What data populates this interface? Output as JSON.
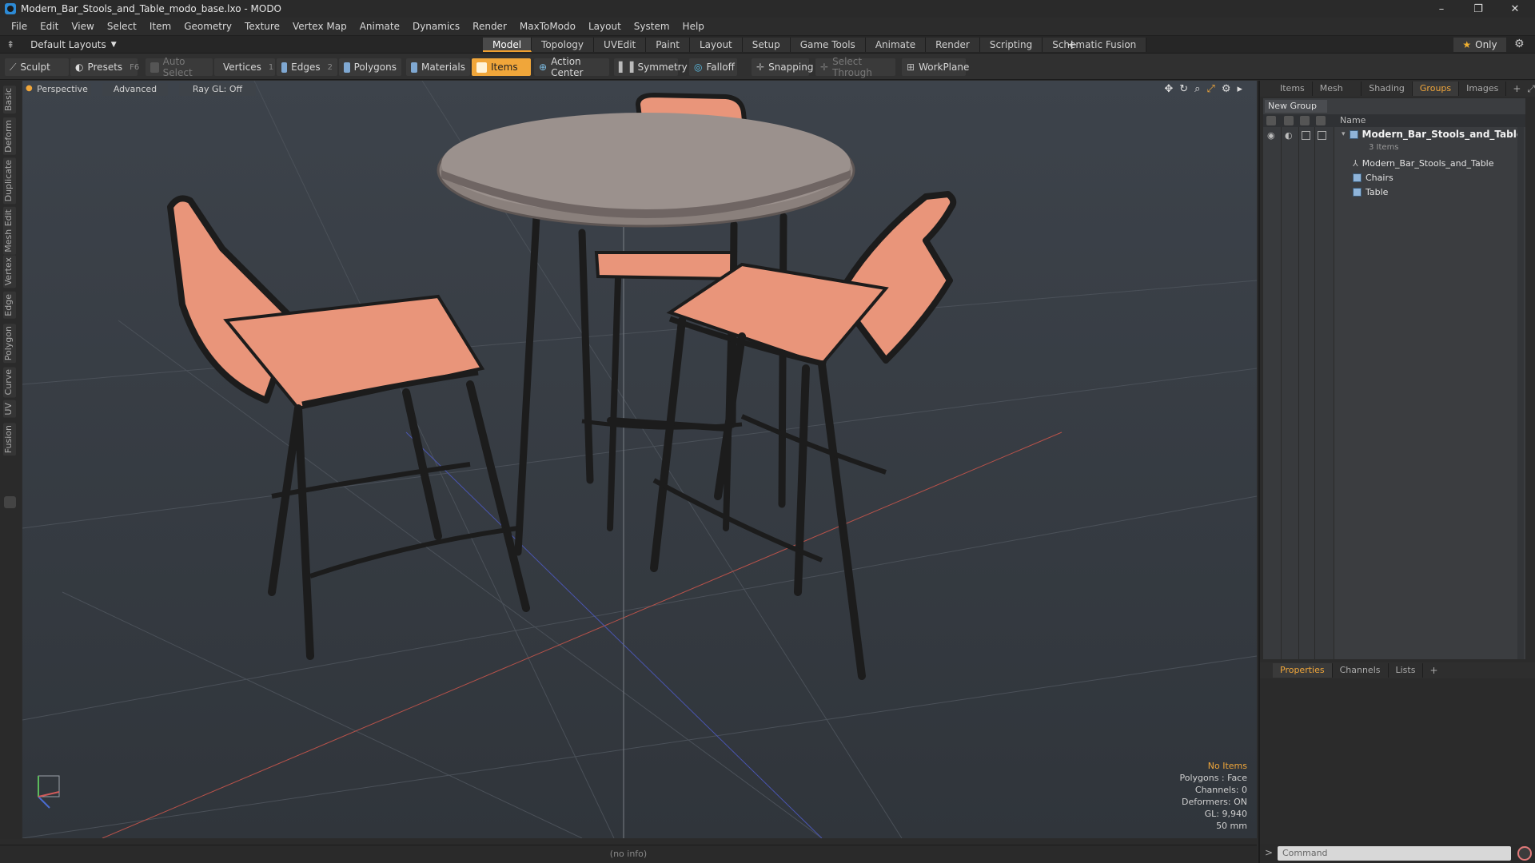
{
  "window": {
    "title": "Modern_Bar_Stools_and_Table_modo_base.lxo - MODO",
    "controls": [
      "–",
      "❐",
      "✕"
    ]
  },
  "menu": [
    "File",
    "Edit",
    "View",
    "Select",
    "Item",
    "Geometry",
    "Texture",
    "Vertex Map",
    "Animate",
    "Dynamics",
    "Render",
    "MaxToModo",
    "Layout",
    "System",
    "Help"
  ],
  "layout": {
    "dropdown": "Default Layouts",
    "tabs": [
      "Model",
      "Topology",
      "UVEdit",
      "Paint",
      "Layout",
      "Setup",
      "Game Tools",
      "Animate",
      "Render",
      "Scripting",
      "Schematic Fusion"
    ],
    "active_tab": "Model",
    "plus": "+",
    "only_label": "Only"
  },
  "toolbar": {
    "sculpt": "Sculpt",
    "presets": "Presets",
    "presets_key": "F6",
    "auto_select": "Auto Select",
    "vertices": "Vertices",
    "vertices_key": "1",
    "edges": "Edges",
    "edges_key": "2",
    "polygons": "Polygons",
    "materials": "Materials",
    "items": "Items",
    "action_center": "Action Center",
    "symmetry": "Symmetry",
    "falloff": "Falloff",
    "snapping": "Snapping",
    "select_through": "Select Through",
    "workplane": "WorkPlane"
  },
  "left_tabs": [
    "Basic",
    "Deform",
    "Duplicate",
    "Mesh Edit",
    "Vertex",
    "Edge",
    "Polygon",
    "Curve",
    "UV",
    "Fusion"
  ],
  "viewport": {
    "view": "Perspective",
    "advanced": "Advanced",
    "raygl": "Ray GL: Off",
    "stats": {
      "selection": "No Items",
      "polygons": "Polygons : Face",
      "channels": "Channels: 0",
      "deformers": "Deformers: ON",
      "gl": "GL: 9,940",
      "scale": "50 mm"
    },
    "colors": {
      "seat": "#e9957a",
      "frame": "#1c1c1c",
      "tabletop": "#8a807c"
    }
  },
  "status": {
    "info": "(no info)"
  },
  "right_panel": {
    "tabs": [
      "Items",
      "Mesh ...",
      "Shading",
      "Groups",
      "Images"
    ],
    "active_tab": "Groups",
    "new_group": "New Group",
    "column_name": "Name",
    "tree": {
      "root": "Modern_Bar_Stools_and_Table",
      "root_count": "3 Items",
      "children": [
        "Modern_Bar_Stools_and_Table",
        "Chairs",
        "Table"
      ]
    },
    "bottom_tabs": [
      "Properties",
      "Channels",
      "Lists"
    ],
    "bottom_active": "Properties",
    "command_placeholder": "Command"
  },
  "accent_color": "#f0a63a"
}
